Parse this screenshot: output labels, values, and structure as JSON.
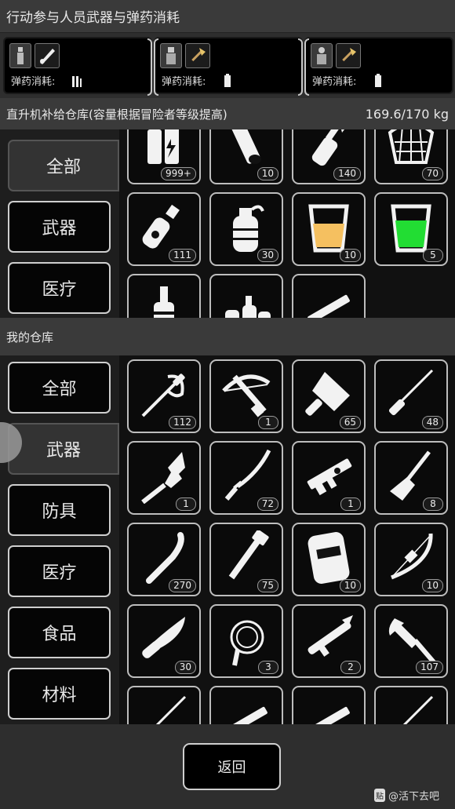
{
  "top": {
    "title": "行动参与人员武器与弹药消耗"
  },
  "party": [
    {
      "ammo_label": "弹药消耗:",
      "weapon_icon": "chainsaw-icon",
      "ammo_icon": "ammo-bullets-icon"
    },
    {
      "ammo_label": "弹药消耗:",
      "weapon_icon": "axe-icon",
      "ammo_icon": "ammo-battery-icon"
    },
    {
      "ammo_label": "弹药消耗:",
      "weapon_icon": "axe-icon",
      "ammo_icon": "ammo-battery-icon"
    }
  ],
  "heli": {
    "title": "直升机补给仓库(容量根据冒险者等级提高)",
    "capacity": "169.6/170 kg",
    "tabs": [
      {
        "label": "全部"
      },
      {
        "label": "武器"
      },
      {
        "label": "医疗"
      }
    ],
    "items": [
      {
        "icon": "battery-icon",
        "count": "999+"
      },
      {
        "icon": "pipe-icon",
        "count": "10"
      },
      {
        "icon": "molotov-icon",
        "count": "140"
      },
      {
        "icon": "net-icon",
        "count": "70"
      },
      {
        "icon": "spray-can-icon",
        "count": "111"
      },
      {
        "icon": "grenade-icon",
        "count": "30"
      },
      {
        "icon": "glass-yellow-icon",
        "count": "10"
      },
      {
        "icon": "glass-green-icon",
        "count": "5"
      },
      {
        "icon": "bottle-icon",
        "count": ""
      },
      {
        "icon": "bottles-icon",
        "count": ""
      },
      {
        "icon": "gun-icon",
        "count": ""
      }
    ]
  },
  "mine": {
    "title": "我的仓库",
    "tabs": [
      {
        "label": "全部"
      },
      {
        "label": "武器"
      },
      {
        "label": "防具"
      },
      {
        "label": "医疗"
      },
      {
        "label": "食品"
      },
      {
        "label": "材料"
      }
    ],
    "items": [
      {
        "icon": "rapier-icon",
        "count": "112"
      },
      {
        "icon": "crossbow-icon",
        "count": "1"
      },
      {
        "icon": "cleaver-icon",
        "count": "65"
      },
      {
        "icon": "spike-icon",
        "count": "48"
      },
      {
        "icon": "serrated-blade-icon",
        "count": "1"
      },
      {
        "icon": "katana-icon",
        "count": "72"
      },
      {
        "icon": "rifle-icon",
        "count": "1"
      },
      {
        "icon": "shovel-icon",
        "count": "8"
      },
      {
        "icon": "club-icon",
        "count": "270"
      },
      {
        "icon": "pipe-wrench-icon",
        "count": "75"
      },
      {
        "icon": "riot-shield-icon",
        "count": "10"
      },
      {
        "icon": "bow-icon",
        "count": "10"
      },
      {
        "icon": "knife-icon",
        "count": "30"
      },
      {
        "icon": "whip-icon",
        "count": "3"
      },
      {
        "icon": "rocket-launcher-icon",
        "count": "2"
      },
      {
        "icon": "hatchet-icon",
        "count": "107"
      },
      {
        "icon": "spike-icon",
        "count": ""
      },
      {
        "icon": "gun-icon",
        "count": ""
      },
      {
        "icon": "gun-icon",
        "count": ""
      },
      {
        "icon": "spike-icon",
        "count": ""
      }
    ]
  },
  "bottom": {
    "back_label": "返回"
  },
  "watermark": {
    "badge": "贴",
    "text": "@活下去吧"
  }
}
